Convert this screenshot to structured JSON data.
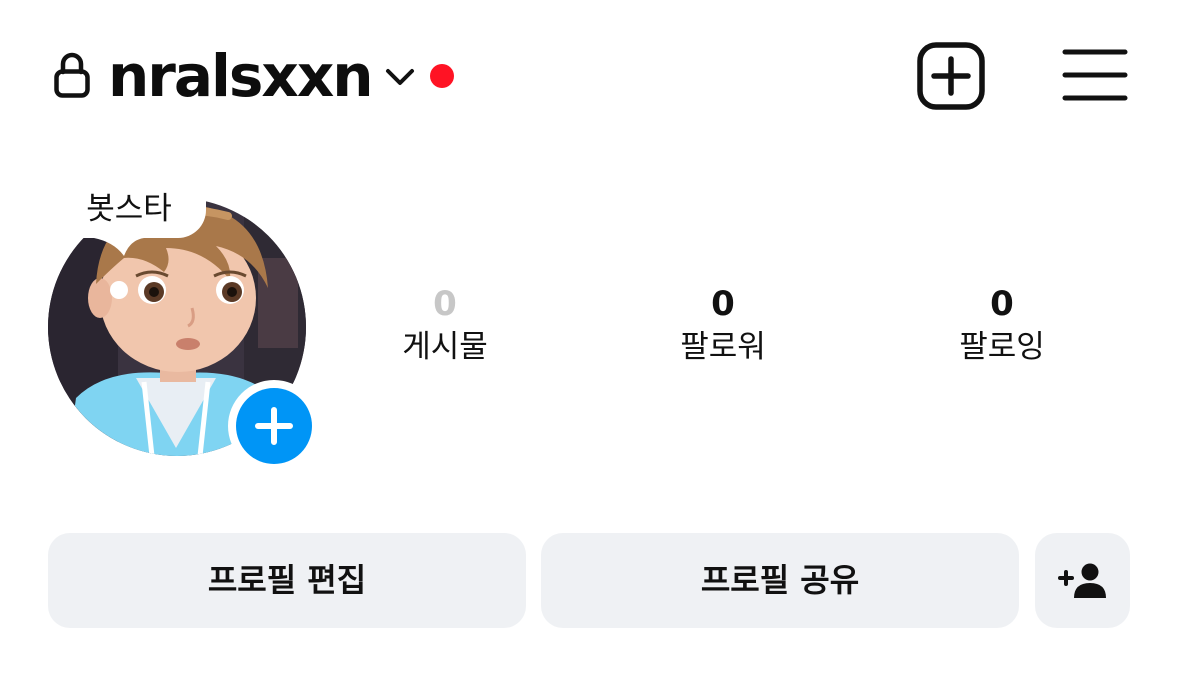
{
  "header": {
    "username": "nralsxxn",
    "icons": {
      "lock": "lock-icon",
      "switch_account": "chevron-down-icon",
      "new_post": "plus-square-icon",
      "menu": "hamburger-menu-icon"
    },
    "notification_dot_color": "#ff1324"
  },
  "profile": {
    "note_text": "봇스타",
    "add_story_color": "#0095f6",
    "stats": [
      {
        "value": "0",
        "label": "게시물"
      },
      {
        "value": "0",
        "label": "팔로워"
      },
      {
        "value": "0",
        "label": "팔로잉"
      }
    ]
  },
  "actions": {
    "edit_profile_label": "프로필 편집",
    "share_profile_label": "프로필 공유",
    "discover_people_icon": "person-add-icon",
    "button_bg": "#eff1f4"
  }
}
